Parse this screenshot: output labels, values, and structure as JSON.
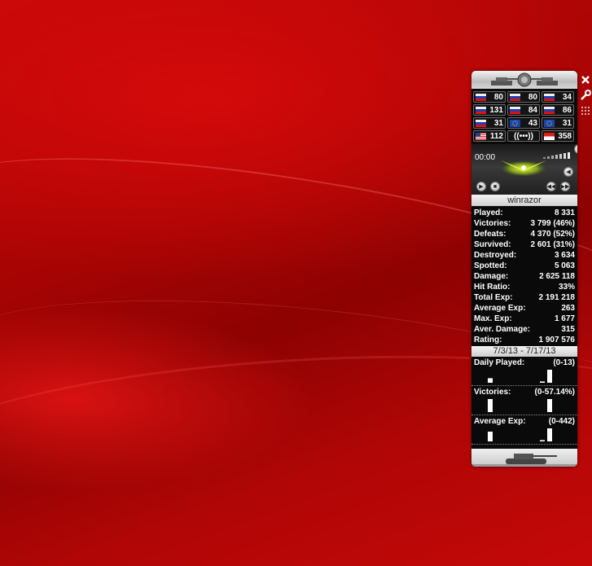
{
  "gadget": {
    "flags": [
      [
        {
          "country": "ussr",
          "value": "80"
        },
        {
          "country": "ussr",
          "value": "80"
        },
        {
          "country": "ussr",
          "value": "34"
        }
      ],
      [
        {
          "country": "ussr",
          "value": "131"
        },
        {
          "country": "ussr",
          "value": "84"
        },
        {
          "country": "ussr",
          "value": "86"
        }
      ],
      [
        {
          "country": "ussr",
          "value": "31"
        },
        {
          "country": "eu",
          "value": "43"
        },
        {
          "country": "eu",
          "value": "31"
        }
      ],
      [
        {
          "country": "usa",
          "value": "112"
        },
        {
          "country": "broadcast",
          "value": "((•••))"
        },
        {
          "country": "singapore",
          "value": "358"
        }
      ]
    ],
    "player": {
      "time": "00:00"
    },
    "username": "winrazor",
    "stats": [
      {
        "label": "Played:",
        "value": "8 331"
      },
      {
        "label": "Victories:",
        "value": "3 799 (46%)"
      },
      {
        "label": "Defeats:",
        "value": "4 370 (52%)"
      },
      {
        "label": "Survived:",
        "value": "2 601 (31%)"
      },
      {
        "label": "Destroyed:",
        "value": "3 634"
      },
      {
        "label": "Spotted:",
        "value": "5 063"
      },
      {
        "label": "Damage:",
        "value": "2 625 118"
      },
      {
        "label": "Hit Ratio:",
        "value": "33%"
      },
      {
        "label": "Total Exp:",
        "value": "2 191 218"
      },
      {
        "label": "Average Exp:",
        "value": "263"
      },
      {
        "label": "Max. Exp:",
        "value": "1 677"
      },
      {
        "label": "Aver. Damage:",
        "value": "315"
      },
      {
        "label": "Rating:",
        "value": "1 907 576"
      }
    ],
    "date_range": "7/3/13 - 7/17/13",
    "mini_charts": [
      {
        "title": "Daily Played:",
        "range": "(0-13)",
        "bars": [
          0.35,
          0.1,
          1.0
        ]
      },
      {
        "title": "Victories:",
        "range": "(0-57.14%)",
        "bars": [
          1.0,
          1.0
        ]
      },
      {
        "title": "Average Exp:",
        "range": "(0-442)",
        "bars": [
          0.75,
          0.1,
          1.0
        ]
      }
    ]
  },
  "side_buttons": {
    "close": "close-icon",
    "settings": "wrench-icon",
    "drag": "grip-icon"
  }
}
